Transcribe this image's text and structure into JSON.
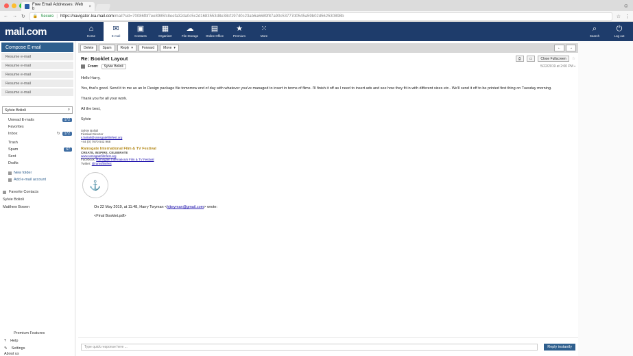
{
  "browser": {
    "tab_title": "Free Email Addresses: Web b",
    "secure_label": "Secure",
    "url_host": "https://navigator-lxa.mail.com",
    "url_path": "/mail?sid=70086fbf7ee8985fc8eefa32da0c5c2d1683553d8e38cf19740c23ab6a6689f87a90c53777d0545a59b02d562530898b"
  },
  "header": {
    "logo": "mail.com",
    "nav": [
      {
        "label": "Home",
        "icon": "home-icon"
      },
      {
        "label": "E-mail",
        "icon": "envelope-icon"
      },
      {
        "label": "Contacts",
        "icon": "contacts-icon"
      },
      {
        "label": "Organizer",
        "icon": "calendar-icon"
      },
      {
        "label": "File Storage",
        "icon": "cloud-icon"
      },
      {
        "label": "Online Office",
        "icon": "office-icon"
      },
      {
        "label": "Premium",
        "icon": "star-icon"
      },
      {
        "label": "More",
        "icon": "grid-icon"
      }
    ],
    "search_label": "Search",
    "logout_label": "Log out"
  },
  "sidebar": {
    "compose": "Compose E-mail",
    "resume": [
      "Resume e-mail",
      "Resume e-mail",
      "Resume e-mail",
      "Resume e-mail",
      "Resume e-mail"
    ],
    "search_value": "Sylvie Bolioli",
    "folders": [
      {
        "label": "Unread E-mails",
        "count": "172"
      },
      {
        "label": "Favorites",
        "count": ""
      },
      {
        "label": "Inbox",
        "count": "172"
      },
      {
        "label": "Trash",
        "count": ""
      },
      {
        "label": "Spam",
        "count": "67"
      },
      {
        "label": "Sent",
        "count": ""
      },
      {
        "label": "Drafts",
        "count": ""
      }
    ],
    "new_folder": "New folder",
    "add_account": "Add e-mail account",
    "favorite_contacts": "Favorite Contacts",
    "contacts": [
      "Sylvie Bolioli",
      "Matthew Bowen"
    ],
    "premium": "Premium Features",
    "help": "Help",
    "settings": "Settings",
    "about": "About us"
  },
  "toolbar": {
    "delete": "Delete",
    "spam": "Spam",
    "reply": "Reply",
    "forward": "Forward",
    "move": "Move"
  },
  "message": {
    "subject": "Re: Booklet Layout",
    "from_label": "From:",
    "from_name": "Sylvie Bolioli",
    "close_fullscreen": "Close Fullscreen",
    "date": "5/22/2019 at 2:00 PM",
    "greeting": "Hello Harry,",
    "para1": "Yes, that's good. Send it to me as an In Design package file tomorrow end of day with whatever you've managed to insert in terms of films. I'll finish it off as I need to insert ads and see how they fit in with different sizes etc.. We'll send it off to be printed first thing on Tuesday morning.",
    "para2": "Thank you for all your work.",
    "closing": "All the best,",
    "signoff": "Sylvie",
    "sig_name": "Sylvie Bolioli",
    "sig_title": "Festival Director",
    "sig_email": "s.bolioli@ramsgatefilmfest.org",
    "sig_phone": "+44 (0) 7970 542 968",
    "fest_name": "Ramsgate International Film & TV Festival",
    "fest_tag": "CREATE, INSPIRE, CELEBRATE",
    "fest_web": "www.ramsgatefilmfest.org",
    "fb_label": "Facebook:",
    "fb_link": "Ramsgate International Film & TV Festival",
    "tw_label": "Twitter:",
    "tw_link": "@ramsfilmfest",
    "quote_line_pre": "On 22 May 2019, at 11:48, Harry Twyman <",
    "quote_email": "hjtwyman@gmail.com",
    "quote_line_post": "> wrote:",
    "quote_attach": "<Final Booklet.pdf>"
  },
  "reply": {
    "placeholder": "Type quick response here ...",
    "button": "Reply instantly"
  }
}
